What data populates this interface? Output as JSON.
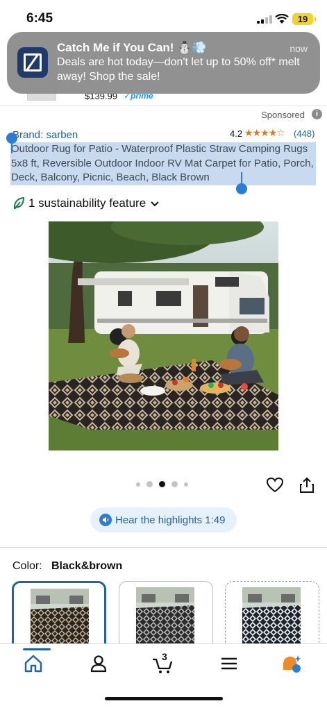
{
  "status_bar": {
    "time": "6:45",
    "battery": "19"
  },
  "notification": {
    "title": "Catch Me if You Can! ⛄💨",
    "time": "now",
    "body": "Deals are hot today—don't let up to 50% off* melt away! Shop the sale!"
  },
  "previous_item": {
    "price": "$139.99",
    "prime": "✓prime"
  },
  "listing": {
    "sponsored_label": "Sponsored",
    "brand": "Brand: sarben",
    "rating": "4.2",
    "stars": "★★★★☆",
    "rating_count": "(448)",
    "title": "Outdoor Rug for Patio - Waterproof Plastic Straw Camping Rugs 5x8 ft, Reversible Outdoor Indoor RV Mat Carpet for Patio, Porch, Deck, Balcony, Picnic, Beach, Black Brown",
    "sustainability": "1 sustainability feature",
    "image_dots": 5,
    "active_dot": 2,
    "highlights_button": "Hear the highlights 1:49"
  },
  "color": {
    "label": "Color:",
    "value": "Black&brown",
    "swatches": [
      "black-brown",
      "black-grey",
      "black-white"
    ],
    "selected": 0
  },
  "bottom_nav": {
    "items": [
      "home-icon",
      "account-icon",
      "cart-icon",
      "menu-icon",
      "rufus-icon"
    ],
    "cart_count": "3"
  },
  "colors": {
    "link_blue": "#2162a1",
    "star_orange": "#de7921",
    "selection_blue": "#2b7cd3",
    "highlight_bg": "#c7daf0"
  }
}
